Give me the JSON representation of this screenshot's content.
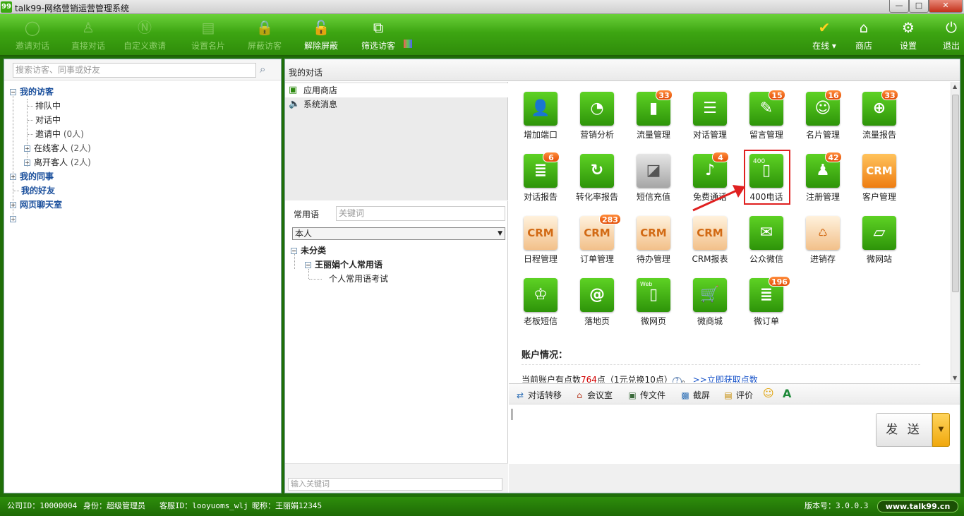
{
  "window": {
    "title": "talk99-网络营销运营管理系统",
    "logo_text": "99",
    "minimize_glyph": "—",
    "maximize_glyph": "□",
    "close_glyph": "✕"
  },
  "toolbar": {
    "items": [
      {
        "label": "邀请对话",
        "icon": "chat-bubble-icon",
        "glyph": "◯",
        "enabled": false
      },
      {
        "label": "直接对话",
        "icon": "person-icon",
        "glyph": "♙",
        "enabled": false
      },
      {
        "label": "自定义邀请",
        "icon": "custom-invite-icon",
        "glyph": "Ⓝ",
        "enabled": false
      },
      {
        "label": "设置名片",
        "icon": "card-icon",
        "glyph": "▤",
        "enabled": false
      },
      {
        "label": "屏蔽访客",
        "icon": "lock-icon",
        "glyph": "🔒",
        "enabled": false
      },
      {
        "label": "解除屏蔽",
        "icon": "unlock-icon",
        "glyph": "🔓",
        "enabled": true
      },
      {
        "label": "筛选访客",
        "icon": "filter-icon",
        "glyph": "⧉",
        "enabled": true
      }
    ],
    "right": [
      {
        "label": "在线",
        "icon": "online-check-icon",
        "glyph": "✔"
      },
      {
        "label": "商店",
        "icon": "home-icon",
        "glyph": "⌂"
      },
      {
        "label": "设置",
        "icon": "gear-icon",
        "glyph": "⚙"
      },
      {
        "label": "退出",
        "icon": "power-icon",
        "glyph": "⏻"
      }
    ],
    "online_dropdown_glyph": "▾"
  },
  "left": {
    "search_placeholder": "搜索访客、同事或好友",
    "search_icon_glyph": "⌕",
    "tree": [
      {
        "label": "我的访客",
        "level": 0,
        "bold": true,
        "expander": "−"
      },
      {
        "label": "排队中",
        "level": 1,
        "bold": false,
        "count": ""
      },
      {
        "label": "对话中",
        "level": 1,
        "bold": false,
        "count": ""
      },
      {
        "label": "邀请中",
        "level": 1,
        "bold": false,
        "count": "(0人)"
      },
      {
        "label": "在线客人",
        "level": 1,
        "bold": false,
        "count": "(2人)",
        "expander": "+"
      },
      {
        "label": "离开客人",
        "level": 1,
        "bold": false,
        "count": "(2人)",
        "expander": "+"
      },
      {
        "label": "我的同事",
        "level": 0,
        "bold": true,
        "expander": "+"
      },
      {
        "label": "我的好友",
        "level": 0,
        "bold": true
      },
      {
        "label": "网页聊天室",
        "level": 0,
        "bold": true,
        "expander": "+"
      },
      {
        "label": "",
        "level": 0,
        "bold": false,
        "expander": "+"
      }
    ]
  },
  "middle": {
    "header": "我的对话",
    "conversations": [
      {
        "label": "应用商店",
        "icon": "store-icon",
        "glyph": "▣",
        "selected": true
      },
      {
        "label": "系统消息",
        "icon": "speaker-icon",
        "glyph": "🔈",
        "selected": false
      }
    ],
    "phrases": {
      "label": "常用语",
      "keyword_placeholder": "关键词",
      "select_value": "本人",
      "select_arrow": "▼",
      "tree": [
        "未分类",
        "王丽娟个人常用语",
        "个人常用语考试"
      ],
      "expander_minus": "−",
      "footer_placeholder": "输入关键词"
    }
  },
  "apps": {
    "colors": {
      "green": "#3fb014",
      "orange": "#f08a1a",
      "badge": "#e8560a",
      "highlight": "#e02020"
    },
    "items": [
      {
        "name": "增加端口",
        "style": "green",
        "glyph": "👤",
        "badge": ""
      },
      {
        "name": "营销分析",
        "style": "green",
        "glyph": "◔",
        "badge": ""
      },
      {
        "name": "流量管理",
        "style": "green",
        "glyph": "▮",
        "badge": "33"
      },
      {
        "name": "对话管理",
        "style": "green",
        "glyph": "☰",
        "badge": ""
      },
      {
        "name": "留言管理",
        "style": "green",
        "glyph": "✎",
        "badge": "15"
      },
      {
        "name": "名片管理",
        "style": "green",
        "glyph": "☺",
        "badge": "16"
      },
      {
        "name": "流量报告",
        "style": "green",
        "glyph": "⊕",
        "badge": "33"
      },
      {
        "name": "对话报告",
        "style": "green",
        "glyph": "≣",
        "badge": "6"
      },
      {
        "name": "转化率报告",
        "style": "green",
        "glyph": "↻",
        "badge": ""
      },
      {
        "name": "短信充值",
        "style": "gray",
        "glyph": "◪",
        "badge": ""
      },
      {
        "name": "免费通话",
        "style": "green",
        "glyph": "♪",
        "badge": "4"
      },
      {
        "name": "400电话",
        "style": "green",
        "glyph": "▯",
        "badge": "",
        "highlight": true
      },
      {
        "name": "注册管理",
        "style": "green",
        "glyph": "♟",
        "badge": "42"
      },
      {
        "name": "客户管理",
        "style": "orange",
        "glyph": "CRM",
        "badge": ""
      },
      {
        "name": "日程管理",
        "style": "beige",
        "glyph": "CRM",
        "badge": ""
      },
      {
        "name": "订单管理",
        "style": "beige",
        "glyph": "CRM",
        "badge": "283"
      },
      {
        "name": "待办管理",
        "style": "beige",
        "glyph": "CRM",
        "badge": ""
      },
      {
        "name": "CRM报表",
        "style": "beige",
        "glyph": "CRM",
        "badge": ""
      },
      {
        "name": "公众微信",
        "style": "green",
        "glyph": "✉",
        "badge": ""
      },
      {
        "name": "进销存",
        "style": "beige",
        "glyph": "♺",
        "badge": ""
      },
      {
        "name": "微网站",
        "style": "green",
        "glyph": "▱",
        "badge": ""
      },
      {
        "name": "老板短信",
        "style": "green",
        "glyph": "♔",
        "badge": ""
      },
      {
        "name": "落地页",
        "style": "green",
        "glyph": "@",
        "badge": ""
      },
      {
        "name": "微网页",
        "style": "green",
        "glyph": "▯",
        "badge": ""
      },
      {
        "name": "微商城",
        "style": "green",
        "glyph": "🛒",
        "badge": ""
      },
      {
        "name": "微订单",
        "style": "green",
        "glyph": "≣",
        "badge": "196"
      }
    ],
    "highlight_sublabel": "400",
    "web_sublabel": "Web",
    "account_title": "账户情况：",
    "account": {
      "prefix": "当前账户有点数",
      "points": "764",
      "suffix": "点（1元兑换10点）",
      "help_glyph": "?",
      "sep": "。",
      "link": ">>立即获取点数"
    },
    "scroll_up": "▲",
    "scroll_down": "▼"
  },
  "chat": {
    "tools": [
      {
        "label": "对话转移",
        "icon": "transfer-icon",
        "glyph": "⇄"
      },
      {
        "label": "会议室",
        "icon": "house-icon",
        "glyph": "⌂"
      },
      {
        "label": "传文件",
        "icon": "file-icon",
        "glyph": "▣"
      },
      {
        "label": "截屏",
        "icon": "screenshot-icon",
        "glyph": "▩"
      },
      {
        "label": "评价",
        "icon": "rate-icon",
        "glyph": "▤"
      }
    ],
    "emoji_glyph": "☺",
    "font_glyph": "A",
    "send_label": "发 送",
    "send_dropdown_glyph": "▼"
  },
  "status": {
    "company": "公司ID：10000004",
    "role": "身份：超级管理员",
    "service_id": "客服ID：looyuoms_wlj",
    "nickname": "昵称：王丽娟12345",
    "version": "版本号：3.0.0.3",
    "site": "www.talk99.cn"
  }
}
